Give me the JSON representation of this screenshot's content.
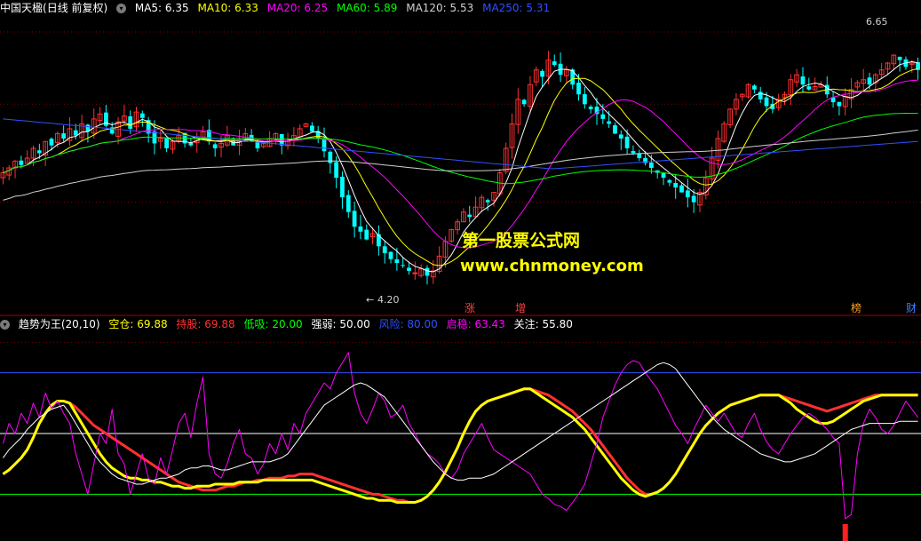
{
  "top": {
    "stock": "中国天楹",
    "period": "(日线 前复权)",
    "ma": [
      {
        "label": "MA5: 6.35",
        "color": "#ffffff"
      },
      {
        "label": "MA10: 6.33",
        "color": "#ffff00"
      },
      {
        "label": "MA20: 6.25",
        "color": "#ff00ff"
      },
      {
        "label": "MA60: 5.89",
        "color": "#00ff00"
      },
      {
        "label": "MA120: 5.53",
        "color": "#d0d0d0"
      },
      {
        "label": "MA250: 5.31",
        "color": "#3050ff"
      }
    ],
    "high_label": "6.65",
    "low_label": "4.20",
    "events": [
      {
        "text": "涨",
        "color": "#ff4040"
      },
      {
        "text": "增",
        "color": "#ff4040"
      },
      {
        "text": "榜",
        "color": "#ffa020"
      },
      {
        "text": "财",
        "color": "#4080ff"
      }
    ]
  },
  "indicator": {
    "name": "趋势为王(20,10)",
    "items": [
      {
        "label": "空仓: 69.88",
        "color": "#ffff00"
      },
      {
        "label": "持股: 69.88",
        "color": "#ff3030"
      },
      {
        "label": "低吸: 20.00",
        "color": "#00ff00"
      },
      {
        "label": "强弱: 50.00",
        "color": "#ffffff"
      },
      {
        "label": "风险: 80.00",
        "color": "#3050ff"
      },
      {
        "label": "启稳: 63.43",
        "color": "#ff00ff"
      },
      {
        "label": "关注: 55.80",
        "color": "#ffffff"
      }
    ]
  },
  "watermark": {
    "line1": "第一股票公式网",
    "line2": "www.chnmoney.com"
  },
  "colors": {
    "up": "#ff3030",
    "down": "#00ffff",
    "grid": "#800000",
    "ma5": "#ffffff",
    "ma10": "#ffff00",
    "ma20": "#ff00ff",
    "ma60": "#00ff00",
    "ma120": "#d0d0d0",
    "ma250": "#3050ff"
  },
  "chart_data": [
    {
      "type": "candlestick",
      "title": "中国天楹 (日线 前复权)",
      "ylim": [
        4.0,
        6.9
      ],
      "closes": [
        5.3,
        5.35,
        5.42,
        5.38,
        5.45,
        5.55,
        5.5,
        5.62,
        5.58,
        5.7,
        5.65,
        5.75,
        5.68,
        5.8,
        5.72,
        5.85,
        5.9,
        5.78,
        5.7,
        5.82,
        5.88,
        5.75,
        5.92,
        5.86,
        5.7,
        5.6,
        5.65,
        5.55,
        5.62,
        5.68,
        5.6,
        5.58,
        5.66,
        5.72,
        5.62,
        5.55,
        5.6,
        5.68,
        5.58,
        5.64,
        5.7,
        5.62,
        5.55,
        5.6,
        5.65,
        5.7,
        5.58,
        5.62,
        5.68,
        5.75,
        5.8,
        5.72,
        5.65,
        5.52,
        5.4,
        5.25,
        5.05,
        4.9,
        4.75,
        4.7,
        4.62,
        4.68,
        4.55,
        4.48,
        4.42,
        4.38,
        4.35,
        4.3,
        4.28,
        4.32,
        4.25,
        4.3,
        4.45,
        4.6,
        4.72,
        4.8,
        4.9,
        4.85,
        4.95,
        5.05,
        5.0,
        5.1,
        5.3,
        5.55,
        5.8,
        6.05,
        6.0,
        6.2,
        6.35,
        6.28,
        6.45,
        6.4,
        6.3,
        6.35,
        6.2,
        6.1,
        6.0,
        5.95,
        5.9,
        5.85,
        5.8,
        5.7,
        5.65,
        5.55,
        5.5,
        5.45,
        5.4,
        5.35,
        5.3,
        5.25,
        5.2,
        5.15,
        5.1,
        5.05,
        5.0,
        5.1,
        5.25,
        5.45,
        5.65,
        5.8,
        5.95,
        6.05,
        6.1,
        6.2,
        6.15,
        6.05,
        5.98,
        5.95,
        6.05,
        6.1,
        6.25,
        6.3,
        6.2,
        6.15,
        6.18,
        6.2,
        6.1,
        6.02,
        5.98,
        6.08,
        6.15,
        6.22,
        6.25,
        6.2,
        6.3,
        6.35,
        6.42,
        6.5,
        6.45,
        6.38,
        6.42,
        6.35
      ],
      "moving_averages": [
        "MA5",
        "MA10",
        "MA20",
        "MA60",
        "MA120",
        "MA250"
      ],
      "annotations": [
        "6.65",
        "4.20"
      ]
    },
    {
      "type": "line",
      "title": "趋势为王(20,10)",
      "ylim": [
        0,
        100
      ],
      "reference_lines": {
        "低吸": 20,
        "强弱": 50,
        "风险": 80
      },
      "series": [
        {
          "name": "持股",
          "color": "#ff3030",
          "values": [
            30,
            32,
            35,
            38,
            42,
            48,
            55,
            60,
            64,
            66,
            66,
            65,
            63,
            60,
            57,
            54,
            52,
            50,
            48,
            46,
            44,
            42,
            40,
            38,
            36,
            34,
            32,
            30,
            28,
            26,
            25,
            24,
            23,
            22,
            22,
            22,
            23,
            24,
            24,
            25,
            26,
            26,
            27,
            27,
            28,
            28,
            28,
            29,
            29,
            30,
            30,
            30,
            29,
            28,
            27,
            26,
            25,
            24,
            23,
            22,
            21,
            20,
            20,
            19,
            18,
            17,
            17,
            16,
            16,
            17,
            19,
            22,
            26,
            31,
            37,
            43,
            50,
            56,
            61,
            64,
            66,
            67,
            68,
            69,
            70,
            71,
            72,
            72,
            71,
            70,
            69,
            67,
            65,
            63,
            61,
            58,
            55,
            52,
            48,
            44,
            40,
            36,
            32,
            28,
            25,
            22,
            20,
            20,
            21,
            23,
            26,
            30,
            35,
            40,
            45,
            50,
            54,
            57,
            60,
            62,
            64,
            65,
            66,
            67,
            68,
            69,
            69,
            69,
            69,
            68,
            67,
            66,
            65,
            64,
            63,
            62,
            61,
            62,
            63,
            64,
            65,
            66,
            67,
            68,
            69,
            69,
            69,
            69,
            69,
            69,
            69,
            69,
            70,
            70
          ]
        },
        {
          "name": "空仓",
          "color": "#ffff00",
          "values": [
            30,
            32,
            35,
            38,
            42,
            48,
            55,
            60,
            64,
            66,
            66,
            65,
            60,
            55,
            50,
            45,
            40,
            36,
            33,
            31,
            29,
            28,
            28,
            27,
            27,
            26,
            26,
            25,
            24,
            24,
            23,
            23,
            24,
            24,
            24,
            25,
            25,
            25,
            25,
            26,
            26,
            26,
            26,
            27,
            27,
            27,
            27,
            27,
            27,
            27,
            27,
            27,
            26,
            25,
            24,
            23,
            22,
            21,
            20,
            19,
            18,
            18,
            17,
            17,
            17,
            16,
            16,
            16,
            16,
            17,
            19,
            22,
            26,
            31,
            37,
            43,
            50,
            56,
            61,
            64,
            66,
            67,
            68,
            69,
            70,
            71,
            72,
            72,
            70,
            68,
            66,
            64,
            62,
            60,
            58,
            55,
            52,
            48,
            44,
            40,
            36,
            32,
            28,
            25,
            22,
            20,
            19,
            20,
            21,
            23,
            26,
            30,
            35,
            40,
            45,
            50,
            54,
            57,
            60,
            62,
            64,
            65,
            66,
            67,
            68,
            69,
            69,
            69,
            69,
            67,
            65,
            62,
            60,
            58,
            56,
            55,
            55,
            56,
            58,
            60,
            62,
            64,
            66,
            67,
            68,
            69,
            69,
            69,
            69,
            69,
            69,
            69,
            70,
            70
          ]
        },
        {
          "name": "启稳",
          "color": "#ff00ff",
          "values": [
            45,
            55,
            50,
            60,
            55,
            65,
            58,
            70,
            62,
            66,
            60,
            55,
            40,
            30,
            20,
            35,
            50,
            45,
            62,
            40,
            35,
            20,
            30,
            40,
            28,
            25,
            38,
            30,
            42,
            55,
            60,
            48,
            65,
            78,
            40,
            30,
            28,
            35,
            45,
            52,
            40,
            38,
            30,
            35,
            45,
            40,
            50,
            42,
            55,
            50,
            60,
            65,
            70,
            75,
            72,
            80,
            85,
            90,
            70,
            60,
            55,
            62,
            70,
            66,
            58,
            60,
            64,
            55,
            50,
            44,
            40,
            38,
            35,
            30,
            28,
            32,
            40,
            45,
            50,
            55,
            48,
            42,
            40,
            38,
            36,
            34,
            32,
            30,
            25,
            20,
            18,
            15,
            14,
            12,
            16,
            20,
            25,
            35,
            45,
            58,
            66,
            74,
            80,
            84,
            86,
            85,
            80,
            76,
            72,
            66,
            60,
            54,
            50,
            45,
            52,
            58,
            64,
            60,
            56,
            60,
            55,
            50,
            48,
            55,
            60,
            52,
            46,
            42,
            40,
            45,
            50,
            54,
            58,
            60,
            58,
            55,
            52,
            48,
            45,
            8,
            10,
            40,
            55,
            62,
            58,
            52,
            50,
            54,
            60,
            66,
            62,
            58,
            60,
            63
          ]
        },
        {
          "name": "关注",
          "color": "#ffffff",
          "values": [
            38,
            42,
            45,
            48,
            52,
            55,
            58,
            60,
            62,
            63,
            64,
            60,
            55,
            50,
            45,
            40,
            36,
            33,
            30,
            28,
            27,
            26,
            25,
            25,
            26,
            27,
            28,
            28,
            29,
            30,
            32,
            33,
            33,
            34,
            34,
            33,
            32,
            32,
            33,
            34,
            35,
            36,
            36,
            36,
            36,
            37,
            38,
            40,
            44,
            48,
            52,
            56,
            60,
            64,
            66,
            68,
            70,
            72,
            74,
            75,
            74,
            72,
            70,
            68,
            64,
            60,
            56,
            52,
            48,
            44,
            40,
            36,
            33,
            30,
            28,
            27,
            27,
            28,
            28,
            28,
            29,
            30,
            32,
            34,
            36,
            38,
            40,
            42,
            44,
            46,
            48,
            50,
            52,
            54,
            56,
            58,
            60,
            62,
            64,
            66,
            68,
            70,
            72,
            74,
            76,
            78,
            80,
            82,
            84,
            85,
            84,
            82,
            78,
            74,
            70,
            66,
            62,
            58,
            55,
            52,
            50,
            48,
            46,
            44,
            42,
            40,
            39,
            38,
            37,
            36,
            36,
            37,
            38,
            39,
            40,
            42,
            44,
            46,
            48,
            50,
            52,
            53,
            54,
            55,
            55,
            55,
            55,
            55,
            56,
            56,
            56,
            56,
            56,
            56
          ]
        }
      ]
    }
  ]
}
